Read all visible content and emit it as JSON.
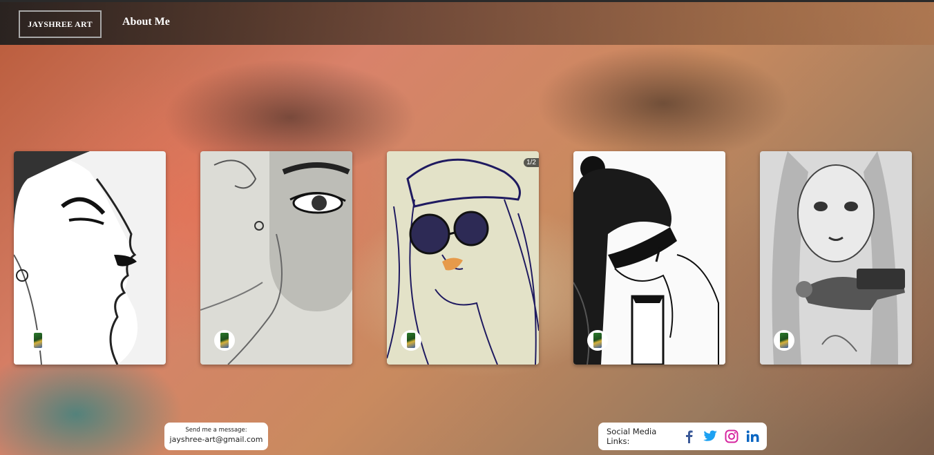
{
  "nav": {
    "logo": "JAYSHREE ART",
    "about": "About Me"
  },
  "gallery": {
    "cards": [
      {
        "avatar_icon": "artist-avatar-icon"
      },
      {
        "avatar_icon": "artist-avatar-icon"
      },
      {
        "avatar_icon": "artist-avatar-icon",
        "counter": "1/2"
      },
      {
        "avatar_icon": "artist-avatar-icon"
      },
      {
        "avatar_icon": "artist-avatar-icon"
      }
    ]
  },
  "contact": {
    "prompt": "Send me a message:",
    "email": "jayshree-art@gmail.com"
  },
  "social": {
    "label": "Social Media Links:",
    "icons": [
      "facebook-icon",
      "twitter-icon",
      "instagram-icon",
      "linkedin-icon"
    ],
    "colors": {
      "facebook": "#3b5998",
      "twitter": "#1da1f2",
      "instagram": "#d6249f",
      "linkedin": "#0a66c2"
    }
  }
}
